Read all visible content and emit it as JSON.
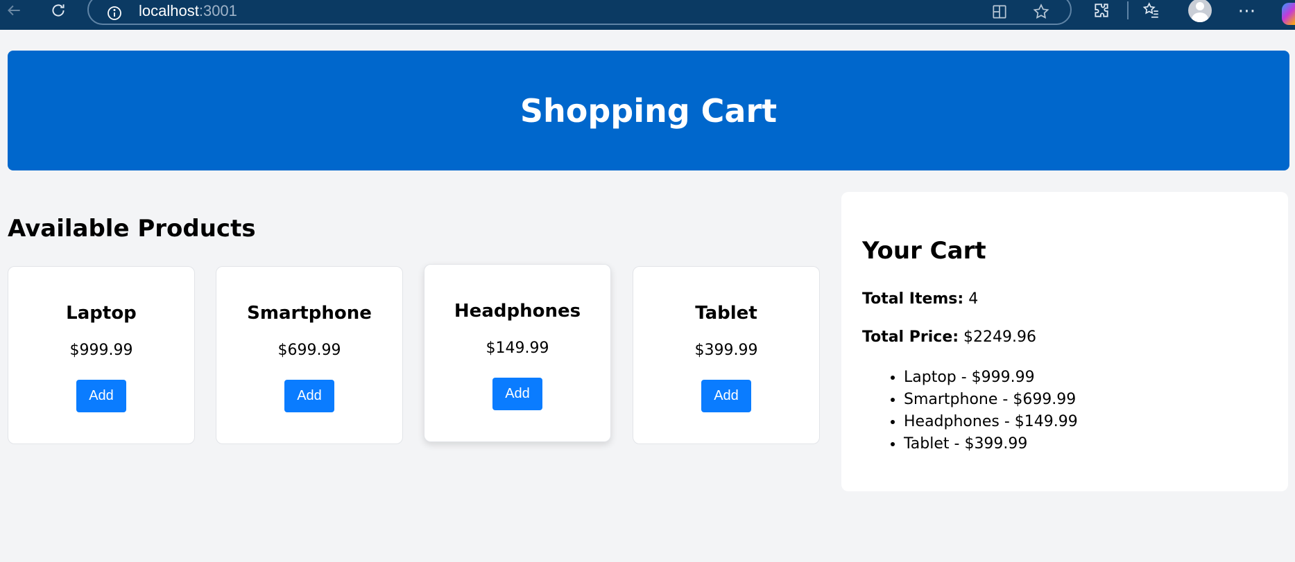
{
  "browser": {
    "url_host": "localhost",
    "url_port": ":3001"
  },
  "header": {
    "title": "Shopping Cart"
  },
  "products_section": {
    "title": "Available Products",
    "products": [
      {
        "name": "Laptop",
        "price": "$999.99",
        "button": "Add"
      },
      {
        "name": "Smartphone",
        "price": "$699.99",
        "button": "Add"
      },
      {
        "name": "Headphones",
        "price": "$149.99",
        "button": "Add"
      },
      {
        "name": "Tablet",
        "price": "$399.99",
        "button": "Add"
      }
    ]
  },
  "cart": {
    "title": "Your Cart",
    "total_items_label": "Total Items:",
    "total_items_value": "4",
    "total_price_label": "Total Price:",
    "total_price_value": "$2249.96",
    "items": [
      "Laptop - $999.99",
      "Smartphone - $699.99",
      "Headphones - $149.99",
      "Tablet - $399.99"
    ]
  },
  "colors": {
    "browser_bar": "#0b3a63",
    "header_bg": "#0067cc",
    "button_bg": "#0a7cff",
    "page_bg": "#f3f4f6"
  }
}
